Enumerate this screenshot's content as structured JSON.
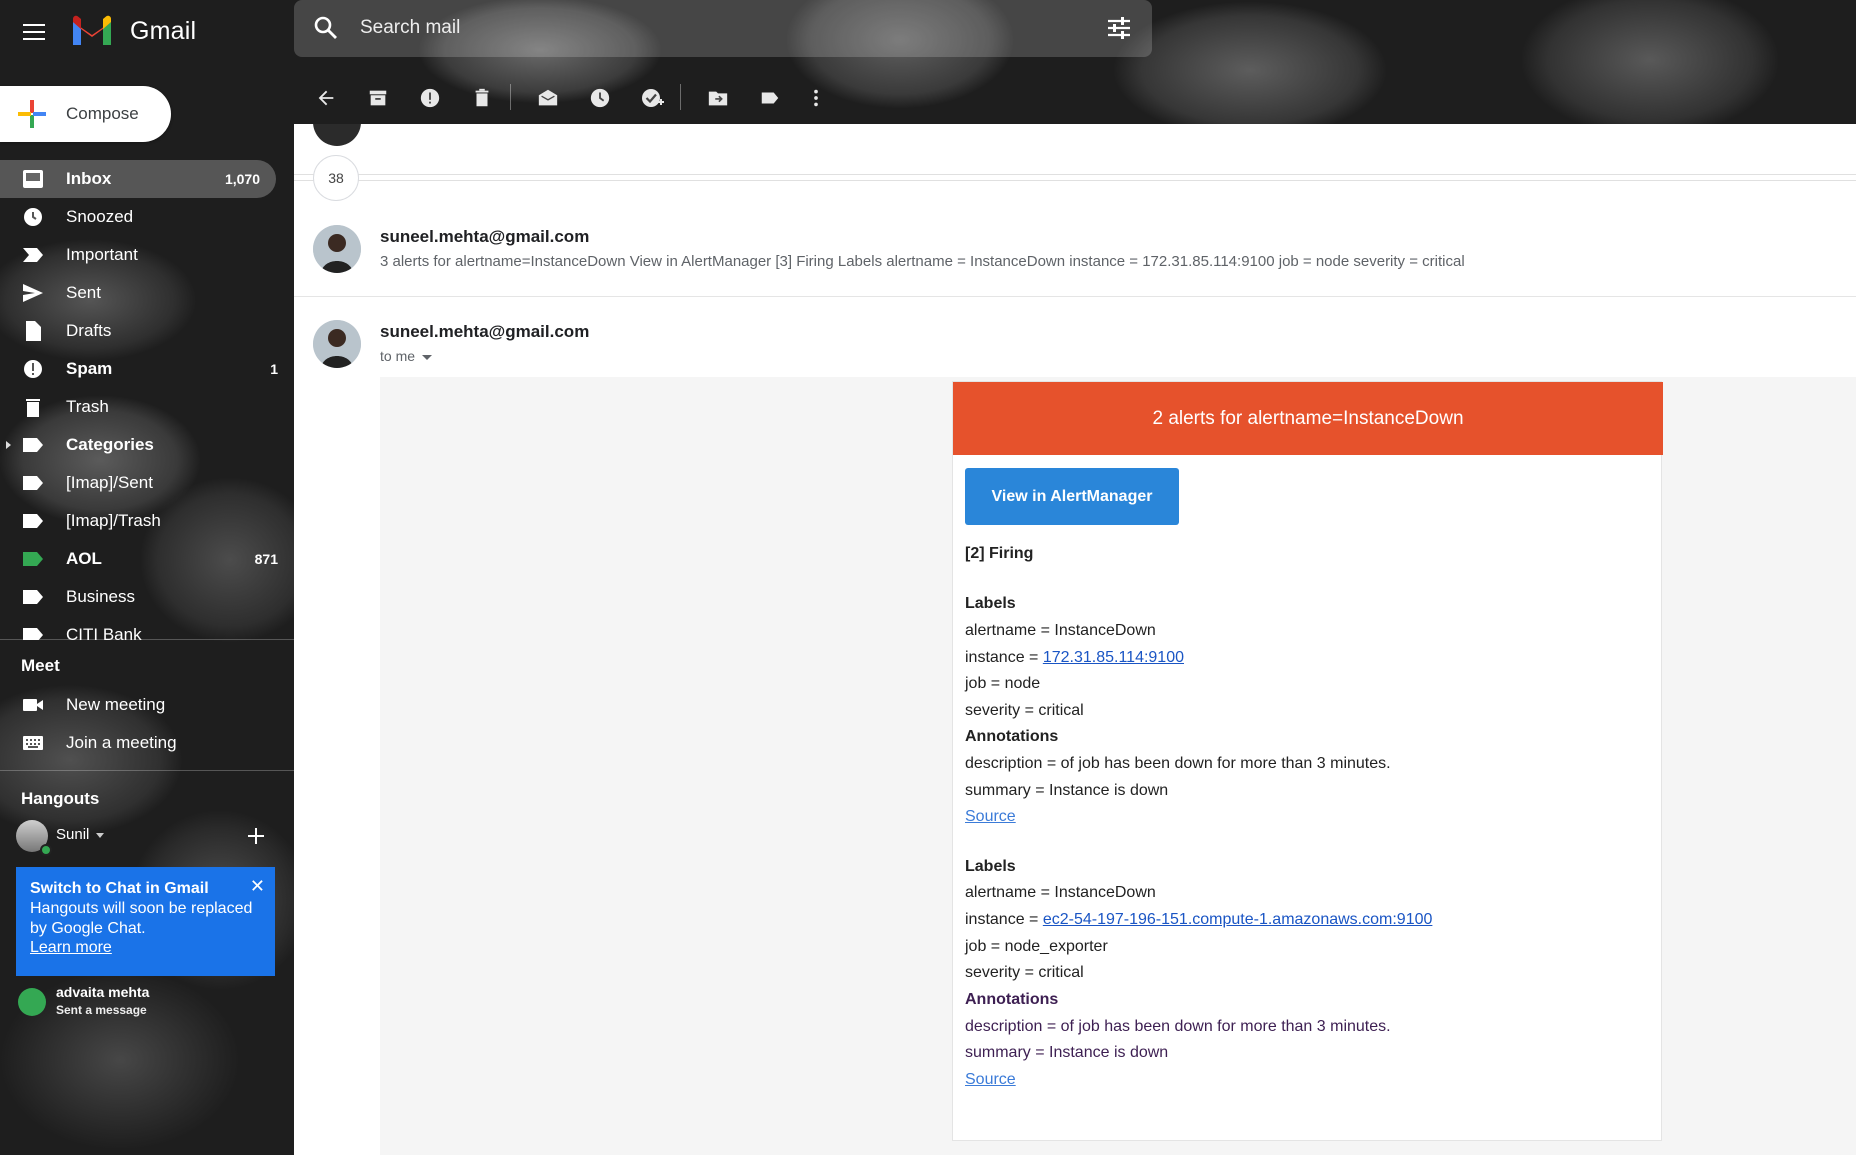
{
  "header": {
    "app_name": "Gmail",
    "search_placeholder": "Search mail"
  },
  "compose": {
    "label": "Compose"
  },
  "nav": [
    {
      "label": "Inbox",
      "count": "1,070",
      "bold": true,
      "active": true,
      "icon": "inbox-icon"
    },
    {
      "label": "Snoozed",
      "count": "",
      "bold": false,
      "icon": "clock-icon"
    },
    {
      "label": "Important",
      "count": "",
      "bold": false,
      "icon": "important-icon"
    },
    {
      "label": "Sent",
      "count": "",
      "bold": false,
      "icon": "send-icon"
    },
    {
      "label": "Drafts",
      "count": "",
      "bold": false,
      "icon": "draft-icon"
    },
    {
      "label": "Spam",
      "count": "1",
      "bold": true,
      "icon": "spam-icon"
    },
    {
      "label": "Trash",
      "count": "",
      "bold": false,
      "icon": "trash-icon"
    },
    {
      "label": "Categories",
      "count": "",
      "bold": true,
      "icon": "label-icon"
    },
    {
      "label": "[Imap]/Sent",
      "count": "",
      "bold": false,
      "icon": "label-icon"
    },
    {
      "label": "[Imap]/Trash",
      "count": "",
      "bold": false,
      "icon": "label-icon"
    },
    {
      "label": "AOL",
      "count": "871",
      "bold": true,
      "icon": "label-icon",
      "color": "#34a853"
    },
    {
      "label": "Business",
      "count": "",
      "bold": false,
      "icon": "label-icon"
    },
    {
      "label": "CITI Bank",
      "count": "",
      "bold": false,
      "icon": "label-icon"
    }
  ],
  "meet": {
    "title": "Meet",
    "new_meeting": "New meeting",
    "join_meeting": "Join a meeting"
  },
  "hangouts": {
    "title": "Hangouts",
    "user": "Sunil",
    "promo_title": "Switch to Chat in Gmail",
    "promo_body": "Hangouts will soon be replaced by Google Chat.",
    "promo_link": "Learn more",
    "promo_close": "✕",
    "contact_name": "advaita mehta",
    "contact_status": "Sent a message"
  },
  "thread": {
    "collapsed_count": "38",
    "message1": {
      "from": "suneel.mehta@gmail.com",
      "snippet": "3 alerts for alertname=InstanceDown View in AlertManager [3] Firing Labels alertname = InstanceDown instance = 172.31.85.114:9100 job = node severity = critical"
    },
    "message2": {
      "from": "suneel.mehta@gmail.com",
      "to": "to me"
    }
  },
  "alert": {
    "header": "2 alerts for alertname=InstanceDown",
    "button": "View in AlertManager",
    "firing": "[2] Firing",
    "groups": [
      {
        "labels_title": "Labels",
        "alertname": "alertname = InstanceDown",
        "instance_prefix": "instance = ",
        "instance_link": "172.31.85.114:9100",
        "job": "job = node",
        "severity": "severity = critical",
        "annotations_title": "Annotations",
        "description": "description = of job has been down for more than 3 minutes.",
        "summary": "summary = Instance is down",
        "source": "Source"
      },
      {
        "labels_title": "Labels",
        "alertname": "alertname = InstanceDown",
        "instance_prefix": "instance = ",
        "instance_link": "ec2-54-197-196-151.compute-1.amazonaws.com:9100",
        "job": "job = node_exporter",
        "severity": "severity = critical",
        "annotations_title": "Annotations",
        "description": "description = of job has been down for more than 3 minutes.",
        "summary": "summary = Instance is down",
        "source": "Source"
      }
    ]
  },
  "colors": {
    "alert_header": "#e6522c",
    "button": "#2a86d9",
    "promo": "#1a73e8"
  }
}
